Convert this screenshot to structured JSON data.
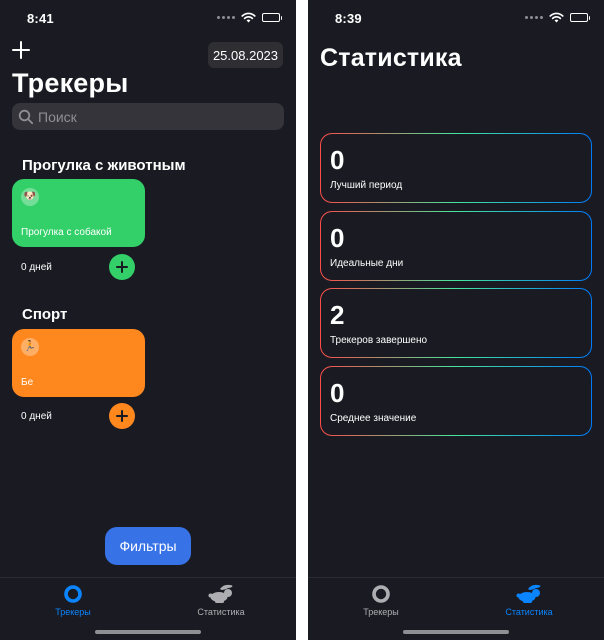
{
  "colors": {
    "background": "#1a1b22",
    "accent": "#3772e7",
    "tab_active": "#0a84ff",
    "tab_inactive": "#aeaeb2",
    "green": "#33cf69",
    "orange": "#ff881e",
    "gradient": [
      "#fd4c49",
      "#46e69d",
      "#007bfa"
    ]
  },
  "left": {
    "status_time": "8:41",
    "date": "25.08.2023",
    "title": "Трекеры",
    "search": {
      "placeholder": "Поиск",
      "icon": "search-icon"
    },
    "categories": [
      {
        "title": "Прогулка с животным",
        "tracker": {
          "emoji": "🐶",
          "name": "Прогулка с собакой",
          "days": "0 дней",
          "color": "#33cf69"
        }
      },
      {
        "title": "Спорт",
        "tracker": {
          "emoji": "🏃",
          "name": "Бе",
          "days": "0 дней",
          "color": "#ff881e"
        }
      }
    ],
    "filters_label": "Фильтры",
    "tabs": [
      {
        "label": "Трекеры",
        "icon": "trackers-icon",
        "active": true
      },
      {
        "label": "Статистика",
        "icon": "rabbit-icon",
        "active": false
      }
    ]
  },
  "right": {
    "status_time": "8:39",
    "title": "Статистика",
    "stats": [
      {
        "value": "0",
        "label": "Лучший период"
      },
      {
        "value": "0",
        "label": "Идеальные дни"
      },
      {
        "value": "2",
        "label": "Трекеров завершено"
      },
      {
        "value": "0",
        "label": "Среднее значение"
      }
    ],
    "tabs": [
      {
        "label": "Трекеры",
        "icon": "trackers-icon",
        "active": false
      },
      {
        "label": "Статистика",
        "icon": "rabbit-icon",
        "active": true
      }
    ]
  }
}
